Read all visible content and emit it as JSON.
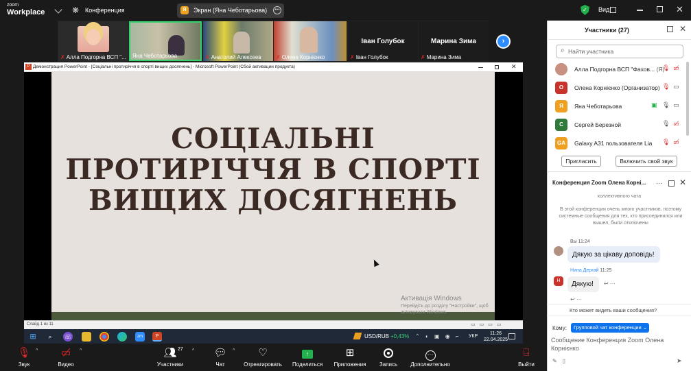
{
  "app": {
    "logo_top": "zoom",
    "logo_bottom": "Workplace",
    "meeting_menu": "Конференция"
  },
  "screen_share": {
    "avatar_letter": "Я",
    "label": "Экран (Яна Чеботарьова)"
  },
  "view": {
    "label": "Вид"
  },
  "thumbnails": [
    {
      "name": "Алла Подгорна ВСП \"..."
    },
    {
      "name": "Яна Чеботарьова"
    },
    {
      "name": "Анатолий Алексеев"
    },
    {
      "name": "Олена Корнієнко"
    },
    {
      "name": "Іван Голубок",
      "big": "Іван Голубок"
    },
    {
      "name": "Марина Зима",
      "big": "Марина Зима"
    }
  ],
  "ppt": {
    "window_title": "Демонстрация PowerPoint - [Соціальні протиріччя в спорті вищих досягнень] - Microsoft PowerPoint (Сбой активации продукта)",
    "slide_title": "СОЦІАЛЬНІ ПРОТИРІЧЧЯ В СПОРТІ ВИЩИХ ДОСЯГНЕНЬ",
    "status": "Слайд 1 из 11",
    "activate_title": "Активація Windows",
    "activate_sub": "Перейдіть до розділу \"Настройки\", щоб активувати Windows."
  },
  "taskbar": {
    "ticker": "USD/RUB",
    "ticker_change": "+0,43%",
    "lang": "УКР",
    "time": "11:26",
    "date": "22.04.2025"
  },
  "toolbar": {
    "audio": "Звук",
    "video": "Видео",
    "participants": "Участники",
    "participants_count": "27",
    "chat": "Чат",
    "react": "Отреагировать",
    "share": "Поделиться",
    "apps": "Приложения",
    "record": "Запись",
    "more": "Дополнительно",
    "leave": "Выйти"
  },
  "participants": {
    "title": "Участники (27)",
    "search_placeholder": "Найти участника",
    "list": [
      {
        "name": "Алла Подгорна ВСП \"Фахов...",
        "suffix": "(Я)",
        "avatar": "",
        "color": "#c89080"
      },
      {
        "name": "Олена Корнієнко (Организатор)",
        "avatar": "О",
        "color": "#c8342c"
      },
      {
        "name": "Яна Чеботарьова",
        "avatar": "Я",
        "color": "#f0a020"
      },
      {
        "name": "Сергей Березной",
        "avatar": "С",
        "color": "#2f7a3a"
      },
      {
        "name": "Galaxy A31 пользователя Lia",
        "avatar": "GA",
        "color": "#f0a020"
      }
    ],
    "invite": "Пригласить",
    "unmute": "Включить свой звук"
  },
  "chat": {
    "title": "Конференция Zoom Олена Корні...",
    "sys1": "коллективного чата",
    "sys2": "В этой конференции очень много участников, поэтому системные сообщения для тех, кто присоединился или вышел, были отключены",
    "me_meta": "Вы 11:24",
    "me_text": "Дякую за цікаву доповідь!",
    "n_name": "Нина Дергай",
    "n_time": "11:25",
    "n_avatar": "Н",
    "n_text": "Дякую!",
    "who_text": "Кто может видеть ваши сообщения?",
    "to_label": "Кому:",
    "to_value": "Групповой чат конференции",
    "input_placeholder": "Сообщение Конференция Zoom Олена Корнієнко"
  }
}
